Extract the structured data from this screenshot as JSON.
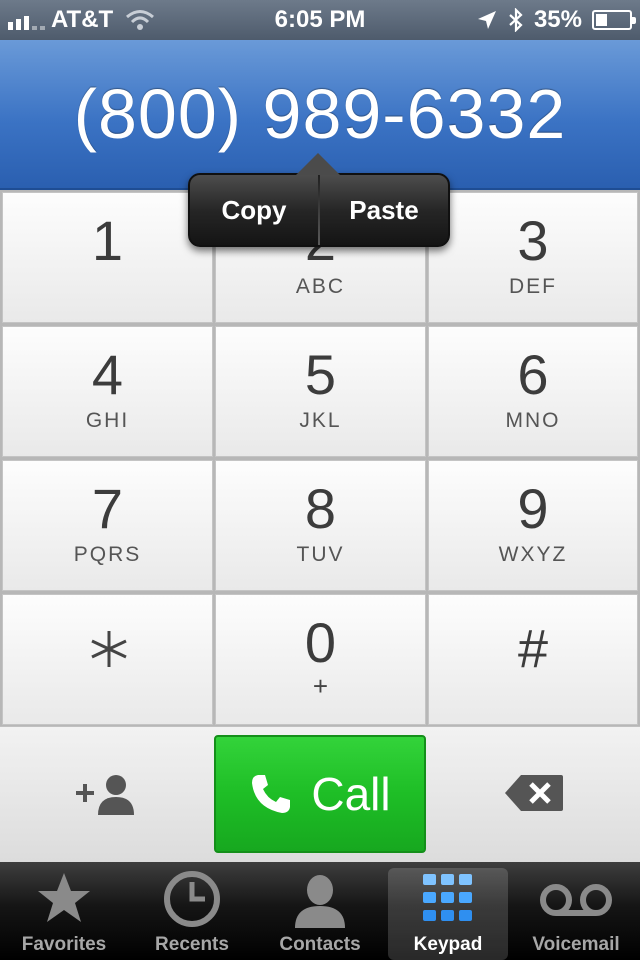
{
  "status_bar": {
    "carrier": "AT&T",
    "time": "6:05 PM",
    "battery": "35%"
  },
  "display": {
    "number": "(800) 989-6332"
  },
  "edit_menu": {
    "copy": "Copy",
    "paste": "Paste"
  },
  "keypad": {
    "keys": [
      {
        "digit": "1",
        "letters": ""
      },
      {
        "digit": "2",
        "letters": "ABC"
      },
      {
        "digit": "3",
        "letters": "DEF"
      },
      {
        "digit": "4",
        "letters": "GHI"
      },
      {
        "digit": "5",
        "letters": "JKL"
      },
      {
        "digit": "6",
        "letters": "MNO"
      },
      {
        "digit": "7",
        "letters": "PQRS"
      },
      {
        "digit": "8",
        "letters": "TUV"
      },
      {
        "digit": "9",
        "letters": "WXYZ"
      },
      {
        "digit": "*",
        "letters": ""
      },
      {
        "digit": "0",
        "letters": "+"
      },
      {
        "digit": "#",
        "letters": ""
      }
    ]
  },
  "actions": {
    "call_label": "Call"
  },
  "tabs": [
    {
      "label": "Favorites",
      "icon": "star-icon"
    },
    {
      "label": "Recents",
      "icon": "clock-icon"
    },
    {
      "label": "Contacts",
      "icon": "person-icon"
    },
    {
      "label": "Keypad",
      "icon": "keypad-icon",
      "active": true
    },
    {
      "label": "Voicemail",
      "icon": "voicemail-icon"
    }
  ],
  "colors": {
    "call_green": "#1ebe26",
    "display_blue": "#3b73c4",
    "active_tab_dots": "#3ea2ff"
  }
}
